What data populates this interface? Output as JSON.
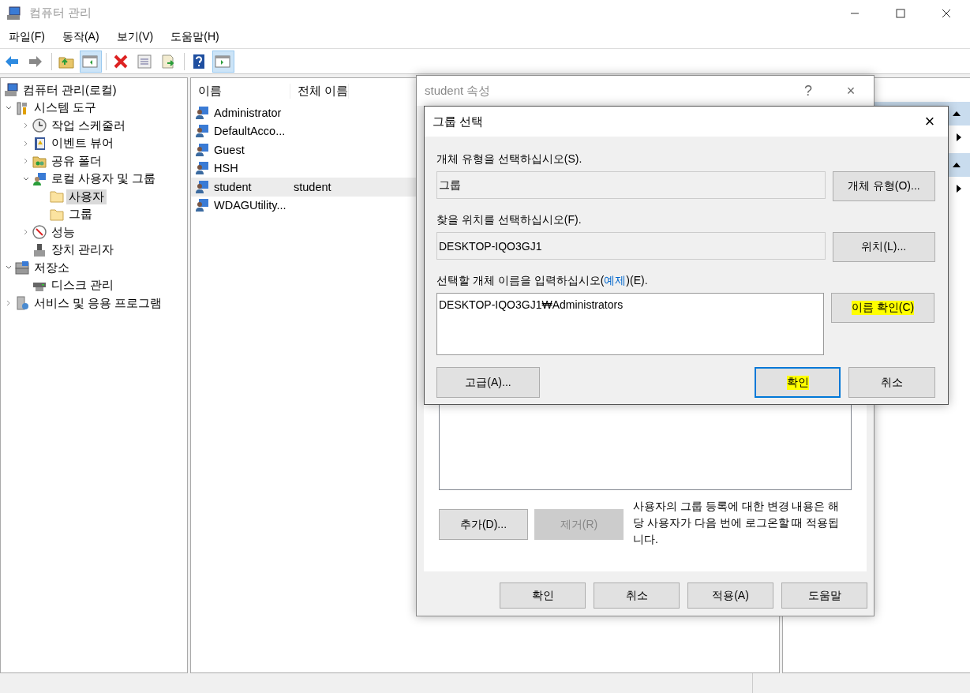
{
  "window": {
    "title": "컴퓨터 관리"
  },
  "menu": [
    {
      "label": "파일(F)"
    },
    {
      "label": "동작(A)"
    },
    {
      "label": "보기(V)"
    },
    {
      "label": "도움말(H)"
    }
  ],
  "toolbar": [
    {
      "selected": false
    },
    {
      "selected": false
    },
    {
      "selected": false
    },
    {
      "selected": true
    },
    {
      "selected": false
    },
    {
      "selected": false
    },
    {
      "selected": false
    },
    {
      "selected": false
    },
    {
      "selected": true
    }
  ],
  "tree": {
    "items": [
      {
        "label": "컴퓨터 관리(로컬)",
        "kind": "computer",
        "selected": false,
        "children": [
          {
            "label": "시스템 도구",
            "kind": "tools",
            "expanded": true,
            "selected": false,
            "children": [
              {
                "label": "작업 스케줄러",
                "kind": "clock",
                "expanded": false,
                "selected": false
              },
              {
                "label": "이벤트 뷰어",
                "kind": "log",
                "expanded": false,
                "selected": false
              },
              {
                "label": "공유 폴더",
                "kind": "share",
                "expanded": false,
                "selected": false
              },
              {
                "label": "로컬 사용자 및 그룹",
                "kind": "users",
                "expanded": true,
                "selected": false,
                "children": [
                  {
                    "label": "사용자",
                    "kind": "folder",
                    "selected": true
                  },
                  {
                    "label": "그룹",
                    "kind": "folder",
                    "selected": false
                  }
                ]
              },
              {
                "label": "성능",
                "kind": "gauge",
                "expanded": false,
                "selected": false
              },
              {
                "label": "장치 관리자",
                "kind": "device",
                "selected": false
              }
            ]
          },
          {
            "label": "저장소",
            "kind": "storage",
            "expanded": true,
            "selected": false,
            "children": [
              {
                "label": "디스크 관리",
                "kind": "disk",
                "selected": false
              }
            ]
          },
          {
            "label": "서비스 및 응용 프로그램",
            "kind": "services",
            "expanded": false,
            "selected": false
          }
        ]
      }
    ]
  },
  "list": {
    "columns": [
      "이름",
      "전체 이름"
    ],
    "rows": [
      {
        "name": "Administrator",
        "selected": false
      },
      {
        "name": "DefaultAcco...",
        "selected": false
      },
      {
        "name": "Guest",
        "selected": false
      },
      {
        "name": "HSH",
        "selected": false
      },
      {
        "name": "student",
        "full_name": "student",
        "selected": true
      },
      {
        "name": "WDAGUtility...",
        "selected": false
      }
    ]
  },
  "actions": [
    {
      "kind": "header"
    },
    {
      "kind": "item"
    },
    {
      "kind": "header"
    },
    {
      "kind": "item"
    }
  ],
  "properties_dialog": {
    "title": "student 속성",
    "help": "?",
    "close": "×",
    "add_button": "추가(D)...",
    "remove_button": {
      "label": "제거(R)",
      "disabled": true
    },
    "note": "사용자의 그룹 등록에 대한 변경 내용은 해당 사용자가 다음 번에 로그온할 때 적용됩니다.",
    "buttons": [
      "확인",
      "취소",
      "적용(A)",
      "도움말"
    ]
  },
  "group_dialog": {
    "title": "그룹 선택",
    "close": "×",
    "object_type_label": "개체 유형을 선택하십시오(S).",
    "object_type": "그룹",
    "object_type_button": "개체 유형(O)...",
    "location_label": "찾을 위치를 선택하십시오(F).",
    "location": "DESKTOP-IQO3GJ1",
    "location_button": "위치(L)...",
    "names_label": {
      "before": "선택할 개체 이름을 입력하십시오(",
      "link": "예제",
      "after": ")(E)."
    },
    "names_value": "DESKTOP-IQO3GJ1₩Administrators",
    "check_names_button": {
      "label": "이름 확인(C)",
      "highlighted": true
    },
    "advanced_button": {
      "label": "고급(A)...",
      "highlighted": false
    },
    "ok_button": {
      "label": "확인",
      "highlighted": true,
      "focused": true
    },
    "cancel_button": {
      "label": "취소",
      "highlighted": false
    }
  }
}
